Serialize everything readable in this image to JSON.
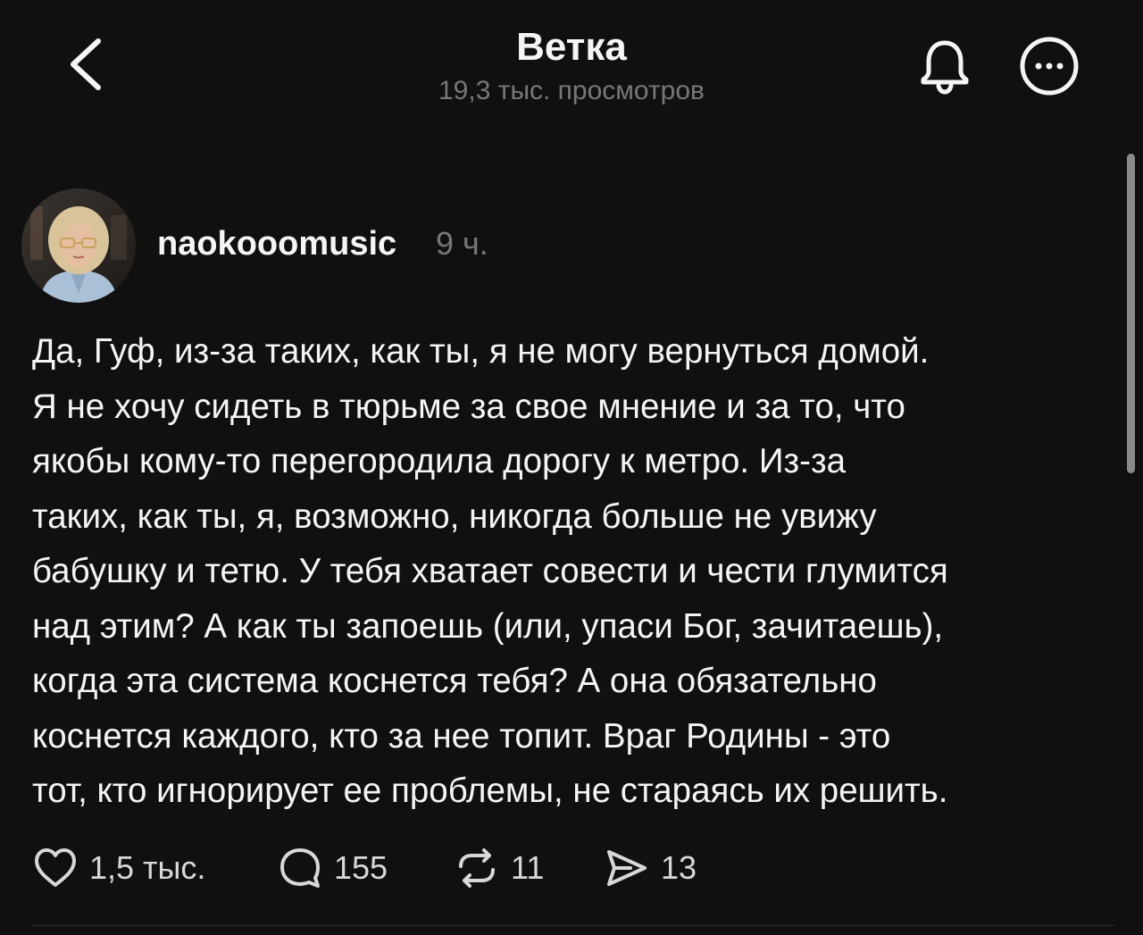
{
  "header": {
    "title": "Ветка",
    "views": "19,3 тыс. просмотров",
    "icons": {
      "back": "chevron-left-icon",
      "notifications": "bell-icon",
      "more": "more-horizontal-icon"
    }
  },
  "post": {
    "author": "naokooomusic",
    "time": "9 ч.",
    "lines": [
      "Да, Гуф, из-за таких, как ты, я не могу вернуться домой.",
      "Я не хочу сидеть в тюрьме за свое мнение и за то, что",
      "якобы кому-то перегородила дорогу к метро. Из-за",
      "таких, как ты, я, возможно, никогда больше не увижу",
      "бабушку и тетю. У тебя хватает совести и чести глумится",
      "над этим? А как ты запоешь (или, упаси Бог, зачитаешь),",
      "когда эта система коснется тебя? А она обязательно",
      "коснется каждого, кто за нее топит. Враг Родины - это",
      "тот, кто игнорирует ее проблемы, не стараясь их решить."
    ]
  },
  "actions": {
    "likes": "1,5 тыс.",
    "replies": "155",
    "reposts": "11",
    "shares": "13"
  },
  "colors": {
    "background": "#101010",
    "text": "#f3f5f7",
    "secondary": "#777777"
  }
}
